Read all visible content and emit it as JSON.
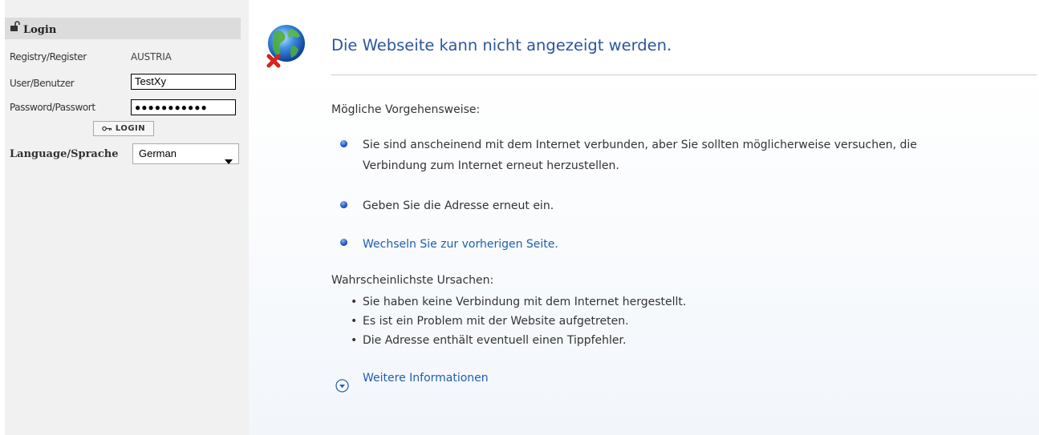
{
  "login_panel": {
    "header": "Login",
    "registry_label": "Registry/Register",
    "registry_value": "AUSTRIA",
    "user_label": "User/Benutzer",
    "user_value": "TestXy",
    "password_label": "Password/Passwort",
    "password_value": "●●●●●●●●●●●",
    "login_button": "LOGIN",
    "language_label": "Language/Sprache",
    "language_value": "German"
  },
  "error_page": {
    "title": "Die Webseite kann nicht angezeigt werden.",
    "actions_heading": "Mögliche Vorgehensweise:",
    "actions": [
      {
        "line1": "Sie sind anscheinend mit dem Internet verbunden, aber Sie sollten möglicherweise versuchen, die",
        "line2": "Verbindung zum Internet erneut herzustellen."
      },
      {
        "line1": "Geben Sie die Adresse erneut ein."
      },
      {
        "line1": "Wechseln Sie zur vorherigen Seite."
      }
    ],
    "causes_heading": "Wahrscheinlichste Ursachen:",
    "causes": [
      "Sie haben keine Verbindung mit dem Internet hergestellt.",
      "Es ist ein Problem mit der Website aufgetreten.",
      "Die Adresse enthält eventuell einen Tippfehler."
    ],
    "more_info": "Weitere Informationen"
  },
  "colors": {
    "title": "#2a55a0",
    "link": "#1e5eb0",
    "panel_bg": "#f1f1f1",
    "panel_header_bg": "#dcdcdc"
  }
}
